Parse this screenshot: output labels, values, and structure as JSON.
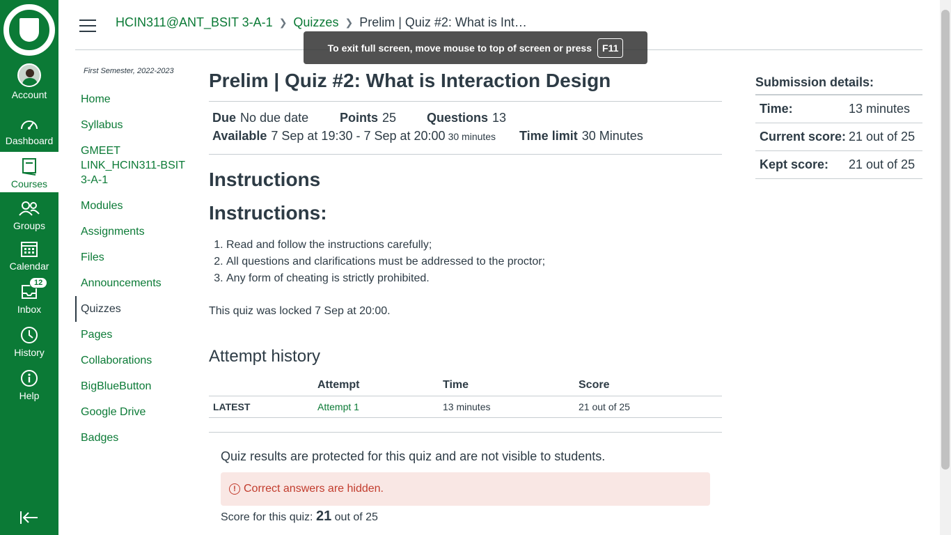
{
  "global_nav": {
    "account": "Account",
    "dashboard": "Dashboard",
    "courses": "Courses",
    "groups": "Groups",
    "calendar": "Calendar",
    "inbox": "Inbox",
    "inbox_count": "12",
    "history": "History",
    "help": "Help",
    "brand_color": "#0b7a36"
  },
  "breadcrumb": {
    "course": "HCIN311@ANT_BSIT 3-A-1",
    "section": "Quizzes",
    "current": "Prelim | Quiz #2: What is Int…"
  },
  "fullscreen_toast": {
    "text": "To exit full screen, move mouse to top of screen or press",
    "key": "F11"
  },
  "course_nav": {
    "term": "First Semester, 2022-2023",
    "items": [
      "Home",
      "Syllabus",
      "GMEET LINK_HCIN311-BSIT 3-A-1",
      "Modules",
      "Assignments",
      "Files",
      "Announcements",
      "Quizzes",
      "Pages",
      "Collaborations",
      "BigBlueButton",
      "Google Drive",
      "Badges"
    ],
    "active": "Quizzes"
  },
  "quiz": {
    "title": "Prelim | Quiz #2: What is Interaction Design",
    "due_label": "Due",
    "due_value": "No due date",
    "points_label": "Points",
    "points_value": "25",
    "questions_label": "Questions",
    "questions_value": "13",
    "available_label": "Available",
    "available_value": "7 Sep at 19:30 - 7 Sep at 20:00",
    "available_duration": "30 minutes",
    "time_limit_label": "Time limit",
    "time_limit_value": "30 Minutes",
    "instructions_heading": "Instructions",
    "instructions_subheading": "Instructions:",
    "instructions": [
      "Read and follow the instructions carefully;",
      "All questions and clarifications must be addressed to the proctor;",
      "Any form of cheating is strictly prohibited."
    ],
    "locked_text": "This quiz was locked 7 Sep at 20:00."
  },
  "attempt_history": {
    "heading": "Attempt history",
    "columns": [
      "",
      "Attempt",
      "Time",
      "Score"
    ],
    "rows": [
      {
        "label": "LATEST",
        "attempt": "Attempt 1",
        "time": "13 minutes",
        "score": "21 out of 25"
      }
    ]
  },
  "results": {
    "protected_text": "Quiz results are protected for this quiz and are not visible to students.",
    "alert_text": "Correct answers are hidden.",
    "score_prefix": "Score for this quiz:",
    "score_value": "21",
    "score_suffix": "out of 25"
  },
  "submission": {
    "heading": "Submission details:",
    "time_label": "Time:",
    "time_value": "13 minutes",
    "current_label": "Current score:",
    "current_value": "21 out of 25",
    "kept_label": "Kept score:",
    "kept_value": "21 out of 25"
  }
}
